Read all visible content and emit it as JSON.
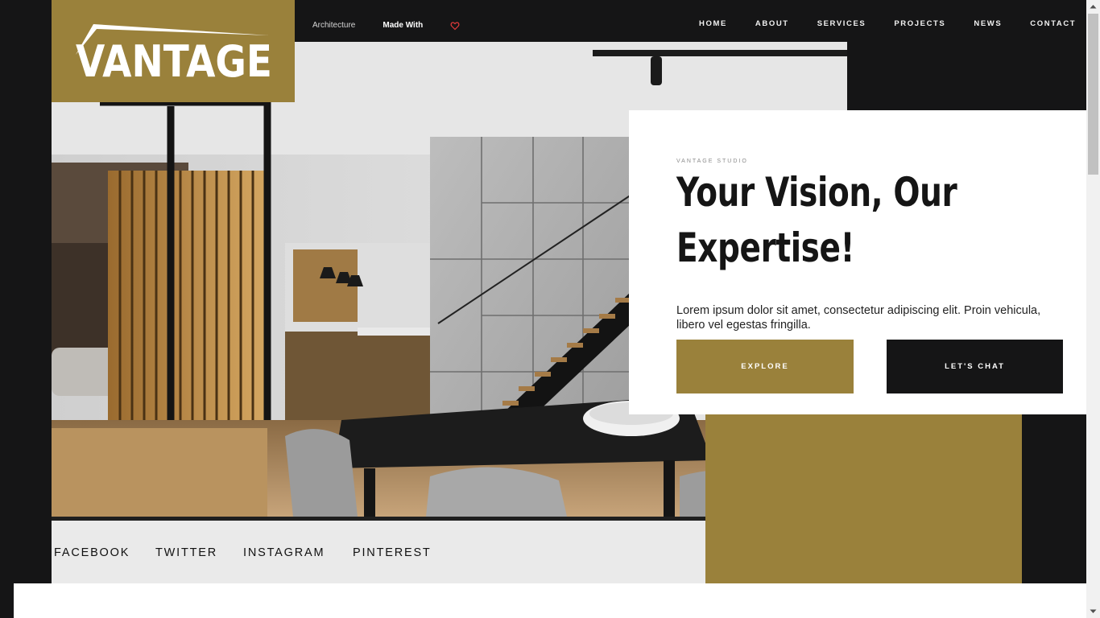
{
  "brand": {
    "logo_text": "VANTAGE",
    "accent": "#9a813b",
    "dark": "#151516"
  },
  "top_links": {
    "architecture": "Architecture",
    "made_with": "Made With",
    "heart_icon": "heart-icon"
  },
  "nav": {
    "items": [
      {
        "label": "HOME"
      },
      {
        "label": "ABOUT"
      },
      {
        "label": "SERVICES"
      },
      {
        "label": "PROJECTS"
      },
      {
        "label": "NEWS"
      },
      {
        "label": "CONTACT"
      }
    ]
  },
  "hero": {
    "eyebrow": "VANTAGE STUDIO",
    "headline": "Your Vision, Our Expertise!",
    "body": "Lorem ipsum dolor sit amet, consectetur adipiscing elit. Proin vehicula, libero vel egestas fringilla.",
    "explore_label": "EXPLORE",
    "chat_label": "LET'S CHAT"
  },
  "social": {
    "items": [
      {
        "label": "FACEBOOK"
      },
      {
        "label": "TWITTER"
      },
      {
        "label": "INSTAGRAM"
      },
      {
        "label": "PINTEREST"
      }
    ]
  }
}
